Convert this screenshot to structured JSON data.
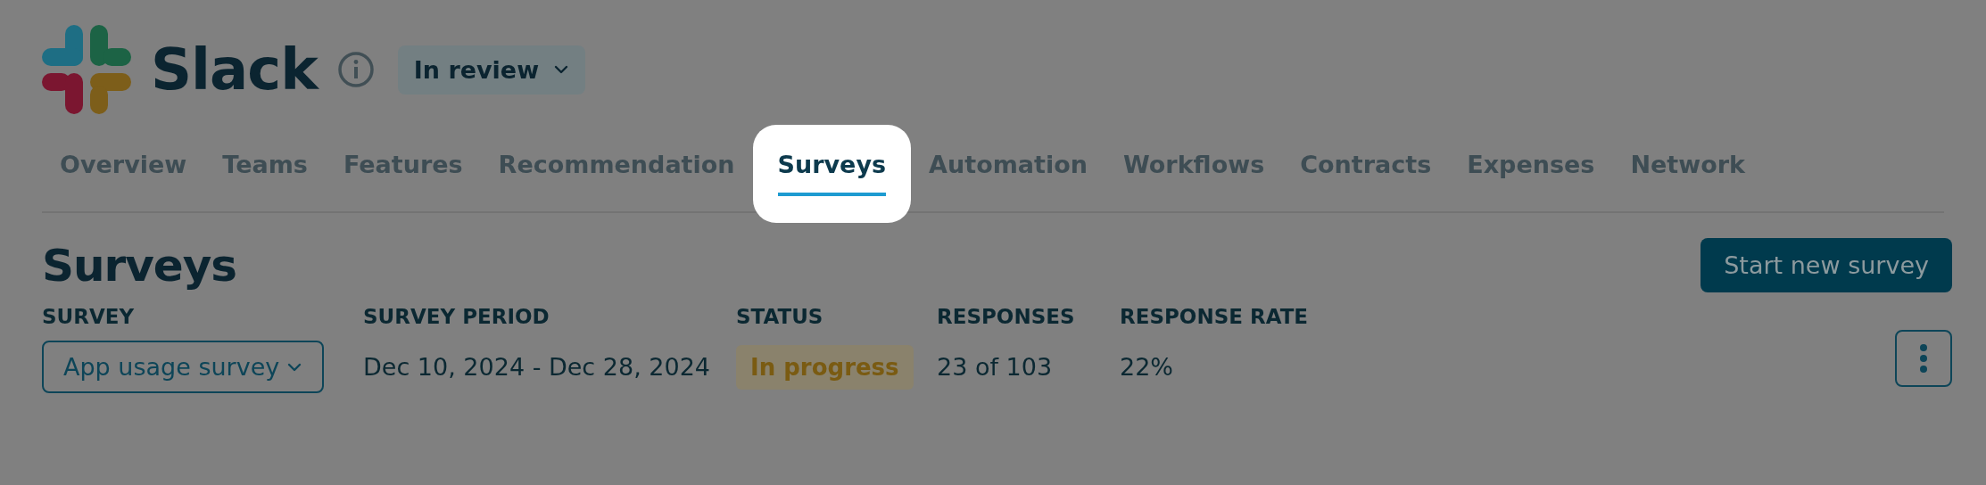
{
  "app": {
    "name": "Slack",
    "status_menu": "In review"
  },
  "tabs": [
    {
      "label": "Overview",
      "selected": false,
      "spotlight": false
    },
    {
      "label": "Teams",
      "selected": false,
      "spotlight": false
    },
    {
      "label": "Features",
      "selected": false,
      "spotlight": false
    },
    {
      "label": "Recommendation",
      "selected": false,
      "spotlight": false
    },
    {
      "label": "Surveys",
      "selected": true,
      "spotlight": true
    },
    {
      "label": "Automation",
      "selected": false,
      "spotlight": false
    },
    {
      "label": "Workflows",
      "selected": false,
      "spotlight": false
    },
    {
      "label": "Contracts",
      "selected": false,
      "spotlight": false
    },
    {
      "label": "Expenses",
      "selected": false,
      "spotlight": false
    },
    {
      "label": "Network",
      "selected": false,
      "spotlight": false
    }
  ],
  "section": {
    "title": "Surveys",
    "primary_button": "Start new survey"
  },
  "table": {
    "columns": [
      "SURVEY",
      "SURVEY PERIOD",
      "STATUS",
      "RESPONSES",
      "RESPONSE RATE"
    ],
    "rows": [
      {
        "cells": [
          {
            "kind": "dropdown",
            "text": "App usage survey"
          },
          {
            "kind": "text",
            "text": "Dec 10, 2024 - Dec 28, 2024"
          },
          {
            "kind": "badge",
            "text": "In progress"
          },
          {
            "kind": "text",
            "text": "23 of 103"
          },
          {
            "kind": "text",
            "text": "22%"
          }
        ]
      }
    ]
  }
}
